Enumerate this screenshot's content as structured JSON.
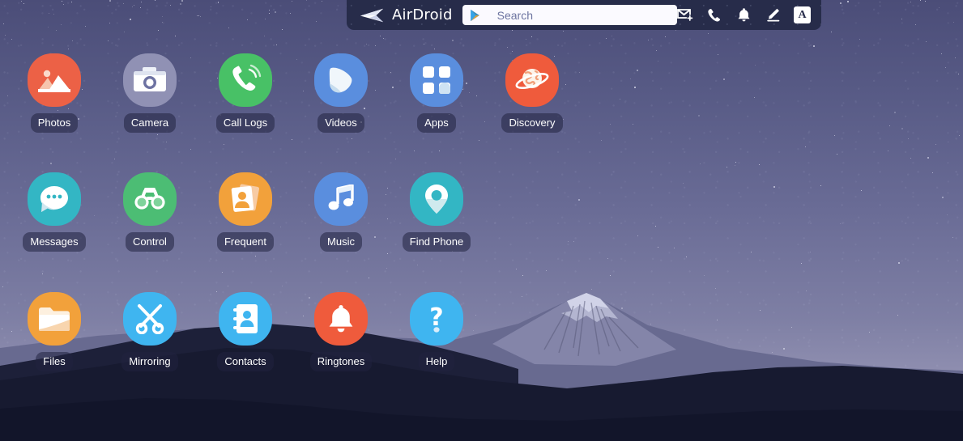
{
  "topbar": {
    "brand_name": "AirDroid",
    "logo_icon": "airdroid-plane-icon",
    "search": {
      "placeholder": "Search",
      "value": "",
      "leading_icon": "google-play-triangle-icon"
    },
    "tools": [
      {
        "name": "new-message-icon",
        "label": "New message"
      },
      {
        "name": "phone-icon",
        "label": "Call"
      },
      {
        "name": "bell-icon",
        "label": "Notifications"
      },
      {
        "name": "pencil-icon",
        "label": "Edit"
      }
    ],
    "account_badge": "A"
  },
  "desktop": {
    "apps": [
      {
        "label": "Photos",
        "icon": "photos-icon",
        "color": "#ec6146",
        "row": 1,
        "col": 1
      },
      {
        "label": "Camera",
        "icon": "camera-icon",
        "color": "#9091b4",
        "row": 1,
        "col": 2
      },
      {
        "label": "Call Logs",
        "icon": "call-logs-icon",
        "color": "#48c166",
        "row": 1,
        "col": 3
      },
      {
        "label": "Videos",
        "icon": "videos-icon",
        "color": "#5a8ede",
        "row": 1,
        "col": 4
      },
      {
        "label": "Apps",
        "icon": "apps-icon",
        "color": "#5a8ede",
        "row": 1,
        "col": 5
      },
      {
        "label": "Discovery",
        "icon": "discovery-icon",
        "color": "#ef5b3c",
        "row": 1,
        "col": 6
      },
      {
        "label": "Messages",
        "icon": "messages-icon",
        "color": "#33b6c4",
        "row": 2,
        "col": 1
      },
      {
        "label": "Control",
        "icon": "control-icon",
        "color": "#4cbd74",
        "row": 2,
        "col": 2
      },
      {
        "label": "Frequent",
        "icon": "frequent-icon",
        "color": "#f2a13b",
        "row": 2,
        "col": 3
      },
      {
        "label": "Music",
        "icon": "music-icon",
        "color": "#5a8ede",
        "row": 2,
        "col": 4
      },
      {
        "label": "Find Phone",
        "icon": "find-phone-icon",
        "color": "#33b6c4",
        "row": 2,
        "col": 5
      },
      {
        "label": "Files",
        "icon": "files-icon",
        "color": "#f2a13b",
        "row": 3,
        "col": 1
      },
      {
        "label": "Mirroring",
        "icon": "mirroring-icon",
        "color": "#3fb5f0",
        "row": 3,
        "col": 2
      },
      {
        "label": "Contacts",
        "icon": "contacts-icon",
        "color": "#3fb5f0",
        "row": 3,
        "col": 3
      },
      {
        "label": "Ringtones",
        "icon": "ringtones-icon",
        "color": "#ef5b3c",
        "row": 3,
        "col": 4
      },
      {
        "label": "Help",
        "icon": "help-icon",
        "color": "#3fb5f0",
        "row": 3,
        "col": 5
      }
    ]
  },
  "wallpaper": {
    "scene": "starry-night-mountain",
    "sky_top_color": "#4b4d78",
    "sky_bottom_color": "#9c9bb9",
    "mountain_color": "#6d6e93",
    "foreground_color": "#191c34"
  }
}
